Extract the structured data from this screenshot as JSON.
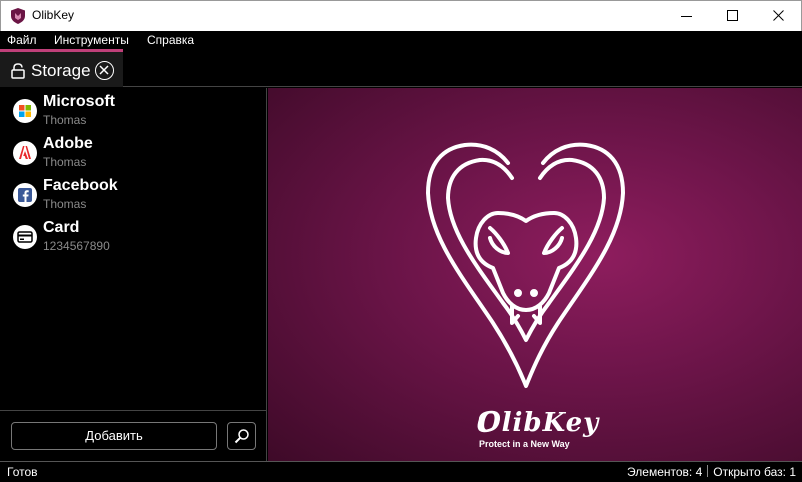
{
  "window": {
    "title": "OlibKey",
    "icon": "shield-logo-icon"
  },
  "menu": {
    "file": "Файл",
    "tools": "Инструменты",
    "help": "Справка"
  },
  "tab": {
    "label": "Storage",
    "lock_icon": "unlock-icon",
    "close_icon": "close-circle-icon"
  },
  "entries": [
    {
      "title": "Microsoft",
      "subtitle": "Thomas",
      "icon": "microsoft-icon"
    },
    {
      "title": "Adobe",
      "subtitle": "Thomas",
      "icon": "adobe-icon"
    },
    {
      "title": "Facebook",
      "subtitle": "Thomas",
      "icon": "facebook-icon"
    },
    {
      "title": "Card",
      "subtitle": "1234567890",
      "icon": "card-icon"
    }
  ],
  "sidebar": {
    "add_label": "Добавить",
    "search_icon": "search-icon"
  },
  "splash": {
    "brand": "OlibKey",
    "tagline": "Protect in a New Way"
  },
  "status": {
    "left": "Готов",
    "elements": "Элементов: 4",
    "open_bases": "Открыто баз: 1"
  },
  "colors": {
    "accent": "#c0407a",
    "background": "#000000",
    "splash_center": "#8e1d5e",
    "splash_edge": "#3e0a28"
  }
}
